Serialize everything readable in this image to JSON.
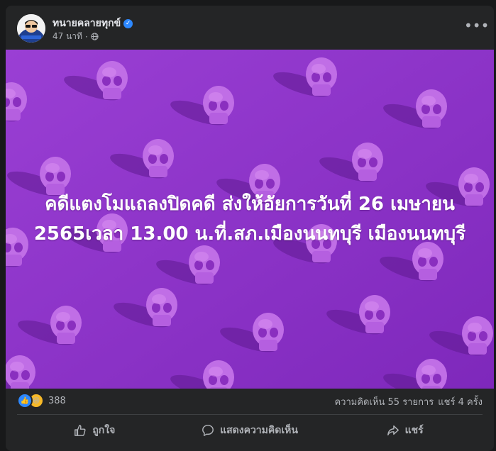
{
  "post": {
    "author": "ทนายคลายทุกข์",
    "time": "47 นาที",
    "meta_separator": "·",
    "image_text": "คดีแตงโมแถลงปิดคดี ส่งให้อัยการวันที่ 26 เมษายน 2565เวลา 13.00 น.ที่.สภ.เมืองนนทบุรี เมืองนนทบุรี",
    "image_background_color": "#8d31c8"
  },
  "stats": {
    "reaction_count": "388",
    "comments": "ความคิดเห็น 55 รายการ",
    "shares": "แชร์ 4 ครั้ง"
  },
  "actions": {
    "like": "ถูกใจ",
    "comment": "แสดงความคิดเห็น",
    "share": "แชร์"
  },
  "icons": {
    "verified": "verified-badge-icon",
    "privacy": "globe-icon",
    "more": "more-options-icon",
    "like": "thumbs-up-icon",
    "comment": "comment-bubble-icon",
    "share": "share-arrow-icon"
  },
  "colors": {
    "card": "#242526",
    "accent_blue": "#2d88ff",
    "haha_yellow": "#f7b928",
    "text_primary": "#e4e6eb",
    "text_secondary": "#b0b3b8"
  }
}
